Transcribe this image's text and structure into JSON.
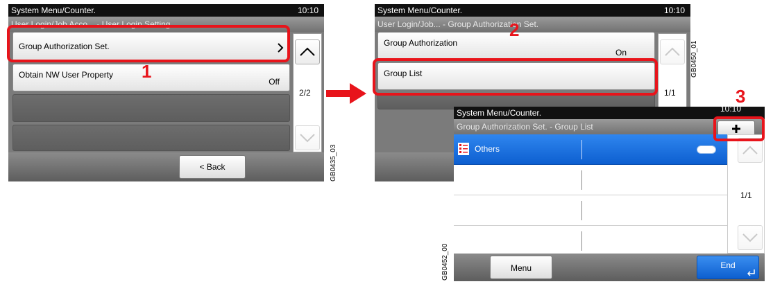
{
  "panel1": {
    "title": "System Menu/Counter.",
    "time": "10:10",
    "subtitle": "User Login/Job Acco... - User Login Setting",
    "rows": [
      {
        "label": "Group Authorization Set.",
        "value": ""
      },
      {
        "label": "Obtain NW User Property",
        "value": "Off"
      }
    ],
    "page": "2/2",
    "back_label": "< Back",
    "figure_id": "GB0435_03"
  },
  "panel2": {
    "title": "System Menu/Counter.",
    "time": "10:10",
    "subtitle": "User Login/Job... - Group Authorization Set.",
    "rows": [
      {
        "label": "Group Authorization",
        "value": "On"
      },
      {
        "label": "Group List",
        "value": ""
      }
    ],
    "page": "1/1",
    "figure_id": "GB0450_01"
  },
  "panel3": {
    "title": "System Menu/Counter.",
    "time": "10:10",
    "subtitle": "Group Authorization Set. - Group List",
    "list_items": [
      "Others"
    ],
    "page": "1/1",
    "menu_label": "Menu",
    "end_label": "End",
    "figure_id": "GB0452_00"
  },
  "callouts": {
    "step1": "1",
    "step2": "2",
    "step3": "3"
  },
  "icons": {
    "up": "chevron-up-icon",
    "down": "chevron-down-icon",
    "right": "chevron-right-icon",
    "add": "plus-icon",
    "arrow": "arrow-right-icon"
  },
  "colors": {
    "callout": "#e8141b",
    "selection": "#0d5fd0"
  }
}
